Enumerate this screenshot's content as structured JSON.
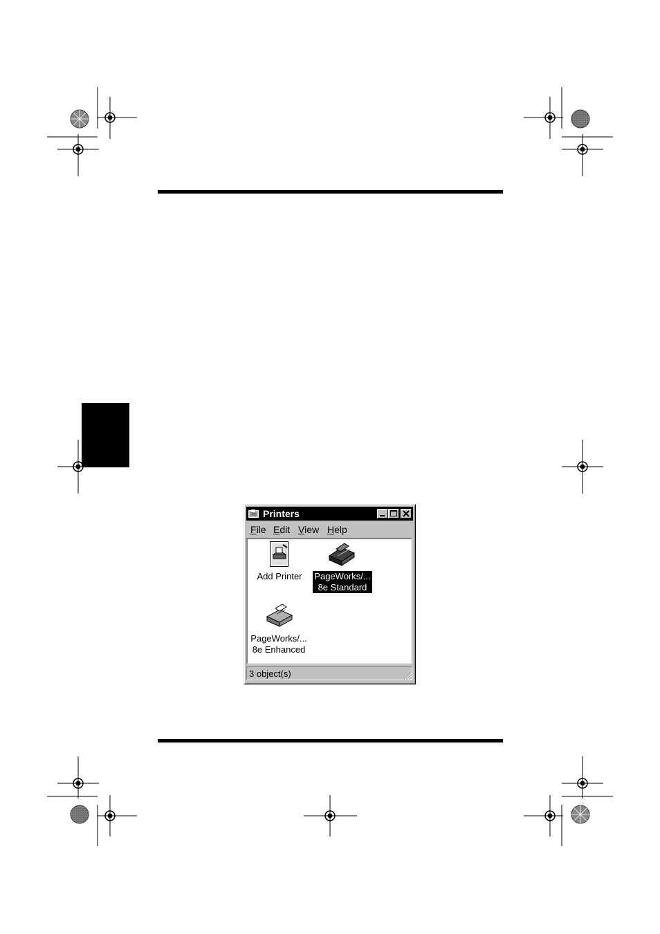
{
  "window": {
    "title": "Printers",
    "menu": [
      {
        "label": "File",
        "mnemonic": "F",
        "rest": "ile"
      },
      {
        "label": "Edit",
        "mnemonic": "E",
        "rest": "dit"
      },
      {
        "label": "View",
        "mnemonic": "V",
        "rest": "iew"
      },
      {
        "label": "Help",
        "mnemonic": "H",
        "rest": "elp"
      }
    ],
    "items": [
      {
        "label": "Add Printer",
        "icon": "add-printer-icon",
        "selected": false
      },
      {
        "label": "PageWorks/...\n8e Standard",
        "icon": "network-printer-icon",
        "selected": true
      },
      {
        "label": "PageWorks/...\n8e Enhanced",
        "icon": "printer-icon",
        "selected": false
      }
    ],
    "status": "3 object(s)"
  },
  "colors": {
    "ink": "#000000",
    "paper": "#ffffff",
    "window_face": "#c0c0c0",
    "registration_grey": "#808080"
  }
}
